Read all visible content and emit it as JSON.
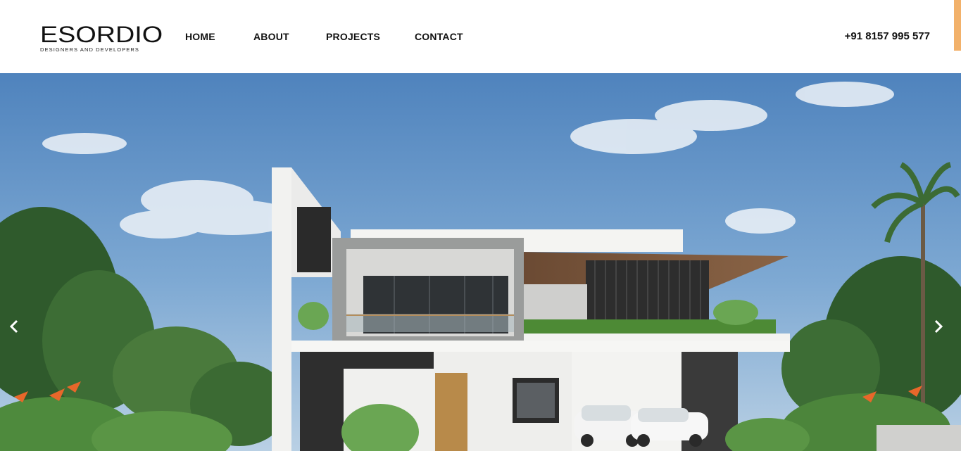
{
  "brand": {
    "name": "ESORDIO",
    "tagline": "DESIGNERS AND DEVELOPERS"
  },
  "nav": {
    "items": [
      {
        "label": "HOME"
      },
      {
        "label": "ABOUT"
      },
      {
        "label": "PROJECTS"
      },
      {
        "label": "CONTACT"
      }
    ]
  },
  "contact": {
    "phone": "+91 8157 995 577"
  },
  "hero": {
    "slide_image": "modern-two-storey-house-render",
    "prev_icon": "chevron-left-icon",
    "next_icon": "chevron-right-icon"
  },
  "colors": {
    "accent": "#f2b16a",
    "text": "#111111",
    "sky": "#5b8fc4"
  }
}
